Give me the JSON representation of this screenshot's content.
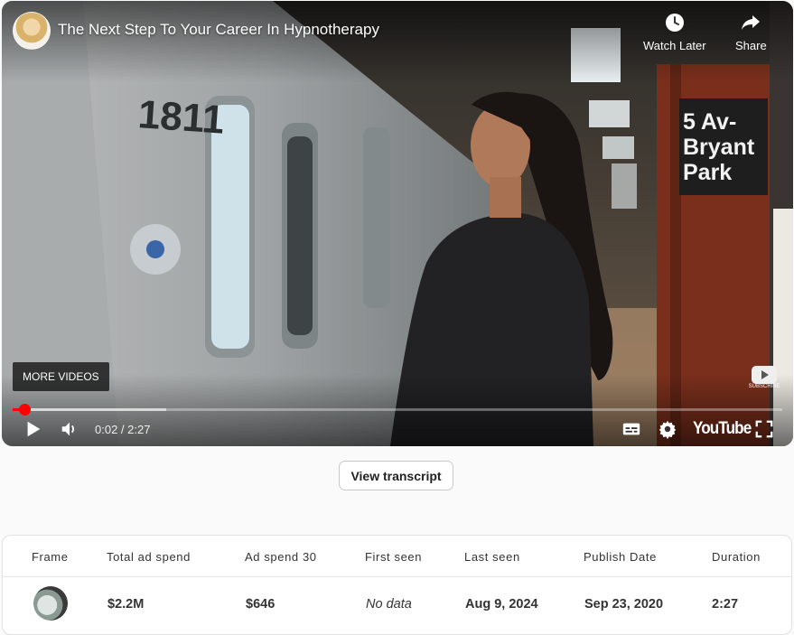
{
  "video": {
    "title": "The Next Step To Your Career In Hypnotherapy",
    "watch_later_label": "Watch Later",
    "share_label": "Share",
    "more_videos_label": "MORE VIDEOS",
    "time_display": "0:02 / 2:27",
    "progress_fraction": 0.015,
    "buffered_fraction": 0.2,
    "brand_label": "YouTube",
    "subscribe_badge_text": "SUBSCRIBE",
    "scene_sign_text": [
      "5 Av-",
      "Bryant",
      "Park"
    ],
    "scene_train_number": "1811",
    "accent_color": "#ff0000"
  },
  "transcript_button_label": "View transcript",
  "table": {
    "headers": [
      "Frame",
      "Total ad spend",
      "Ad spend 30",
      "First seen",
      "Last seen",
      "Publish Date",
      "Duration"
    ],
    "row": {
      "total_ad_spend": "$2.2M",
      "ad_spend_30": "$646",
      "first_seen": "No data",
      "last_seen": "Aug 9, 2024",
      "publish_date": "Sep 23, 2020",
      "duration": "2:27"
    }
  }
}
